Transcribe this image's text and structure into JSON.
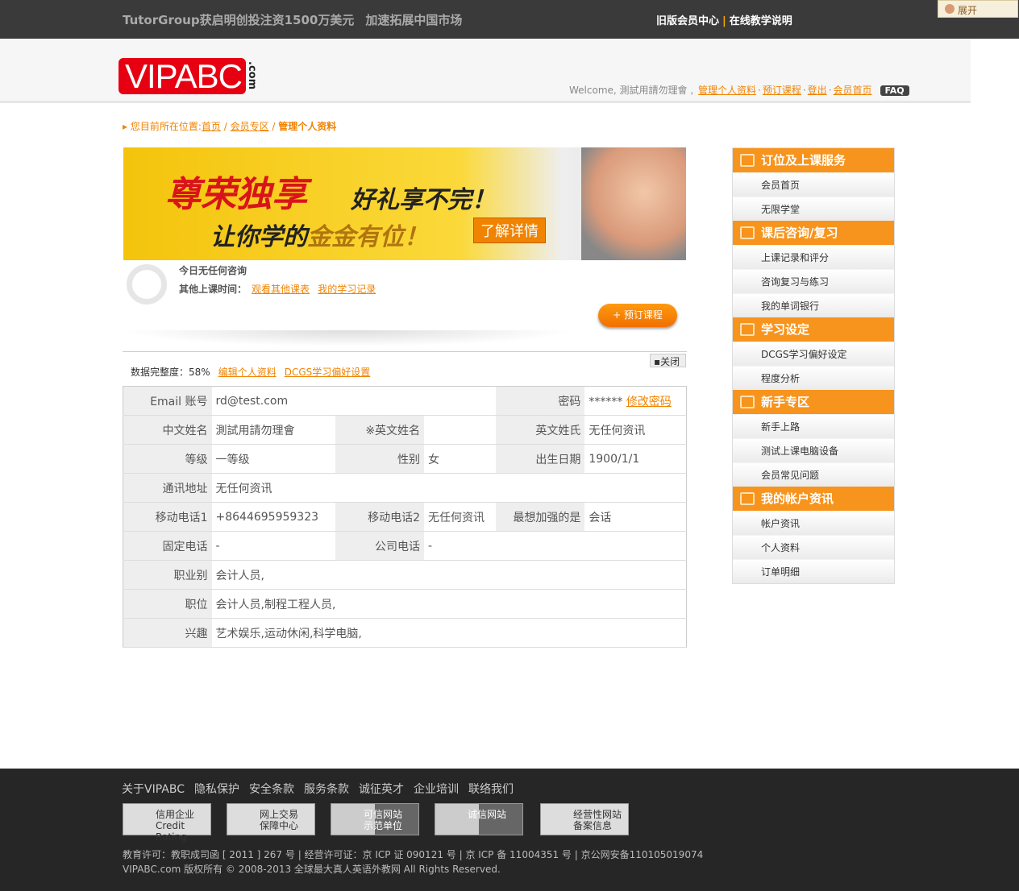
{
  "topbar": {
    "news": [
      "TutorGroup获启明创投注资1500万美元",
      "加速拓展中国市场"
    ],
    "old_center": "旧版会员中心",
    "online_help": "在线教学说明",
    "expand": "展开"
  },
  "header": {
    "logo": "VIPABC",
    "logo_suffix": ".com",
    "welcome": "Welcome, 測試用請勿理會 ,",
    "links": [
      "管理个人资料",
      "预订课程",
      "登出",
      "会员首页"
    ],
    "faq": "FAQ"
  },
  "breadcrumb": {
    "prefix": "您目前所在位置:",
    "home": "首页",
    "section": "会员专区",
    "current": "管理个人资料"
  },
  "banner": {
    "line1": "尊荣独享",
    "line2": "好礼享不完！",
    "line3a": "让你学的",
    "line3b": "金金有位！",
    "button": "了解详情"
  },
  "schedule": {
    "today": "今日无任何咨询",
    "other_label": "其他上课时间：",
    "link1": "观看其他课表",
    "link2": "我的学习记录",
    "book": "+ 预订课程"
  },
  "profile": {
    "close": "关闭",
    "completeness_label": "数据完整度：",
    "completeness": "58%",
    "edit": "编辑个人资料",
    "dcgs": "DCGS学习偏好设置",
    "email_label": "Email 账号",
    "email": "rd@test.com",
    "pwd_label": "密码",
    "pwd": "******",
    "change_pwd": "修改密码",
    "cn_label": "中文姓名",
    "cn": "測試用請勿理會",
    "en_label": "※英文姓名",
    "en": "",
    "en_last_label": "英文姓氏",
    "en_last": "无任何资讯",
    "level_label": "等级",
    "level": "一等级",
    "gender_label": "性别",
    "gender": "女",
    "dob_label": "出生日期",
    "dob": "1900/1/1",
    "addr_label": "通讯地址",
    "addr": "无任何资讯",
    "m1_label": "移动电话1",
    "m1": "+8644695959323",
    "m2_label": "移动电话2",
    "m2": "无任何资讯",
    "want_label": "最想加强的是",
    "want": "会话",
    "fixed_label": "固定电话",
    "fixed": "-",
    "office_label": "公司电话",
    "office": "-",
    "job_label": "职业别",
    "job": "会计人员,",
    "pos_label": "职位",
    "pos": "会计人员,制程工程人员,",
    "hobby_label": "兴趣",
    "hobby": "艺术娱乐,运动休闲,科学电脑,"
  },
  "sidebar": [
    {
      "title": "订位及上课服务",
      "icon": "book-icon",
      "items": [
        "会员首页",
        "无限学堂"
      ]
    },
    {
      "title": "课后咨询/复习",
      "icon": "book-icon",
      "items": [
        "上课记录和评分",
        "咨询复习与练习",
        "我的单词银行"
      ]
    },
    {
      "title": "学习设定",
      "icon": "settings-icon",
      "items": [
        "DCGS学习偏好设定",
        "程度分析"
      ]
    },
    {
      "title": "新手专区",
      "icon": "megaphone-icon",
      "items": [
        "新手上路",
        "测试上课电脑设备",
        "会员常见问题"
      ]
    },
    {
      "title": "我的帐户资讯",
      "icon": "clipboard-icon",
      "items": [
        "帐户资讯",
        "个人资料",
        "订单明细"
      ]
    }
  ],
  "footer": {
    "links": [
      "关于VIPABC",
      "隐私保护",
      "安全条款",
      "服务条款",
      "诚征英才",
      "企业培训",
      "联络我们"
    ],
    "badges": [
      [
        "信用企业",
        "Credit Rating"
      ],
      [
        "网上交易",
        "保障中心"
      ],
      [
        "可信网站",
        "示范单位"
      ],
      [
        "诚信网站",
        ""
      ],
      [
        "经营性网站",
        "备案信息"
      ]
    ],
    "license": "教育许可：教职成司函 [ 2011 ] 267 号 | 经营许可证：京 ICP 证 090121 号 | 京 ICP 备 11004351 号 | 京公网安备110105019074",
    "copyright": "VIPABC.com 版权所有 © 2008-2013 全球最大真人英语外教网 All Rights Reserved."
  }
}
